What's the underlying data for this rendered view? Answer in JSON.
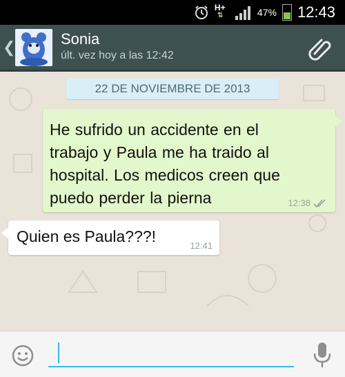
{
  "status_bar": {
    "network": "H+",
    "battery_percent": "47%",
    "battery_level": 0.47,
    "time": "12:43",
    "icons": [
      "alarm-icon",
      "network-hplus-icon",
      "signal-icon",
      "battery-icon"
    ]
  },
  "header": {
    "contact_name": "Sonia",
    "last_seen": "últ. vez hoy a las 12:42",
    "icons": [
      "back-chevron-icon",
      "avatar",
      "attach-paperclip-icon"
    ]
  },
  "chat": {
    "date_label": "22 DE NOVIEMBRE DE 2013",
    "messages": [
      {
        "direction": "outgoing",
        "lines": [
          "He sufrido un accidente en el",
          "trabajo y Paula me ha traido al",
          "hospital. Los medicos creen que",
          "puedo perder la pierna"
        ],
        "time": "12:38",
        "status_icon": "double-check-icon"
      },
      {
        "direction": "incoming",
        "text": "Quien es Paula???!",
        "time": "12:41"
      }
    ]
  },
  "input_bar": {
    "value": "",
    "icons": [
      "emoji-icon",
      "microphone-icon"
    ]
  },
  "colors": {
    "header_bg": "#3f5051",
    "outgoing_bubble": "#e2f7cb",
    "incoming_bubble": "#ffffff",
    "date_pill": "#d9eef7",
    "accent": "#34b7f1"
  }
}
